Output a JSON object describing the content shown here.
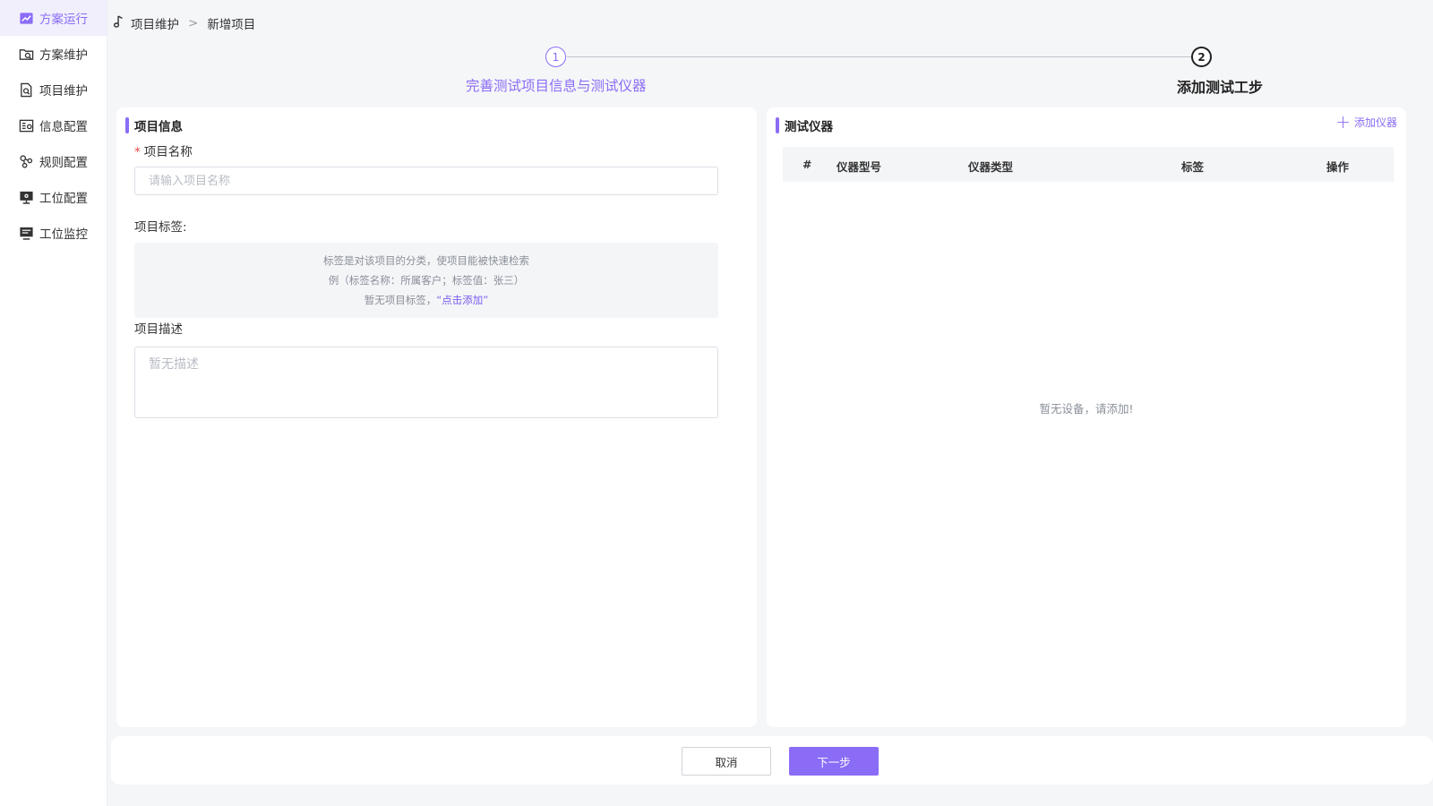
{
  "sidebar": {
    "items": [
      {
        "label": "方案运行",
        "icon": "chart-line-icon",
        "active": true
      },
      {
        "label": "方案维护",
        "icon": "folder-search-icon",
        "active": false
      },
      {
        "label": "项目维护",
        "icon": "document-search-icon",
        "active": false
      },
      {
        "label": "信息配置",
        "icon": "settings-table-icon",
        "active": false
      },
      {
        "label": "规则配置",
        "icon": "nodes-icon",
        "active": false
      },
      {
        "label": "工位配置",
        "icon": "monitor-gear-icon",
        "active": false
      },
      {
        "label": "工位监控",
        "icon": "monitor-list-icon",
        "active": false
      }
    ]
  },
  "breadcrumb": {
    "items": [
      "项目维护",
      "新增项目"
    ],
    "separator": ">"
  },
  "steps": [
    {
      "number": "1",
      "label": "完善测试项目信息与测试仪器",
      "state": "current"
    },
    {
      "number": "2",
      "label": "添加测试工步",
      "state": "pending"
    }
  ],
  "project_info": {
    "title": "项目信息",
    "name_label": "项目名称",
    "name_placeholder": "请输入项目名称",
    "name_value": "",
    "tags_label": "项目标签:",
    "tags_hint_1": "标签是对该项目的分类，使项目能被快速检索",
    "tags_hint_2": "例（标签名称：所属客户；标签值：张三）",
    "tags_empty_prefix": "暂无项目标签，",
    "tags_add_link": "“点击添加”",
    "desc_label": "项目描述",
    "desc_placeholder": "暂无描述"
  },
  "instruments": {
    "title": "测试仪器",
    "add_button": "添加仪器",
    "columns": [
      "#",
      "仪器型号",
      "仪器类型",
      "标签",
      "操作"
    ],
    "rows": [],
    "empty_text": "暂无设备，请添加!"
  },
  "footer": {
    "cancel_label": "取消",
    "next_label": "下一步"
  },
  "colors": {
    "accent": "#8b6cf6",
    "active_bg": "#f1effc",
    "page_bg": "#f5f6f8"
  }
}
